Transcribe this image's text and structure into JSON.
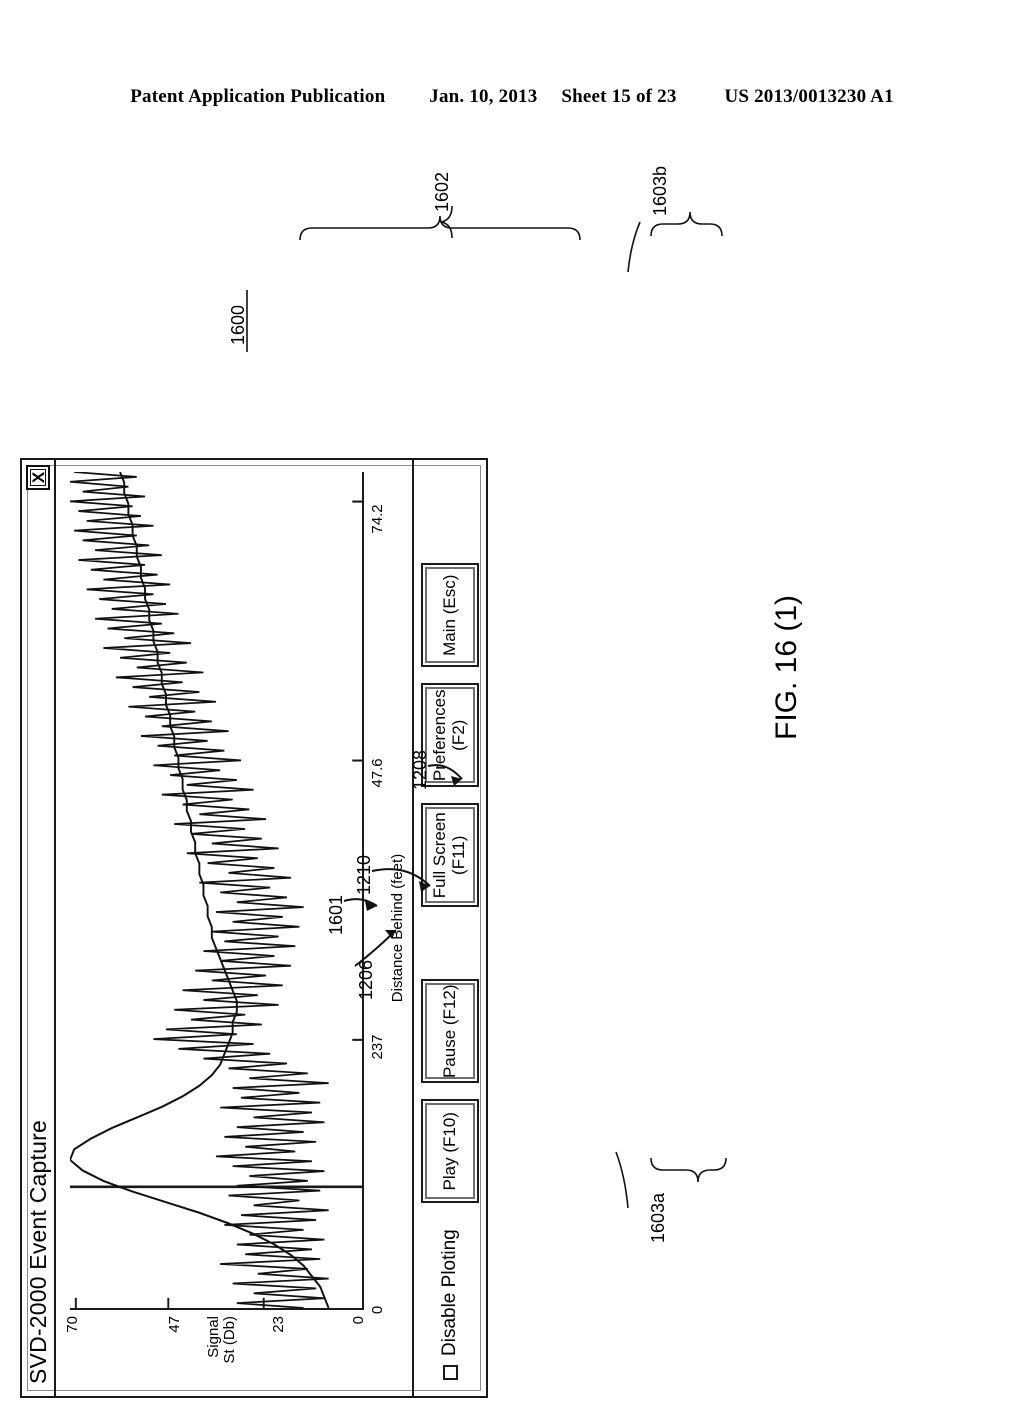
{
  "patent_header": {
    "publication": "Patent Application Publication",
    "date": "Jan. 10, 2013",
    "sheet": "Sheet 15 of 23",
    "number": "US 2013/0013230 A1"
  },
  "figure": {
    "caption": "FIG. 16 (1)",
    "reference_numerals": [
      {
        "id": "1600",
        "label": "1600"
      },
      {
        "id": "1601",
        "label": "1601"
      },
      {
        "id": "1602",
        "label": "1602"
      },
      {
        "id": "1603a",
        "label": "1603a"
      },
      {
        "id": "1603b",
        "label": "1603b"
      },
      {
        "id": "1206",
        "label": "1206"
      },
      {
        "id": "1208",
        "label": "1208"
      },
      {
        "id": "1210",
        "label": "1210"
      }
    ]
  },
  "window": {
    "title": "SVD-2000 Event Capture",
    "close_label": "X"
  },
  "controls": {
    "checkbox_label": "Disable Ploting",
    "checkbox_checked": false,
    "buttons": [
      {
        "label": "Play (F10)",
        "name": "play-button"
      },
      {
        "label": "Pause (F12)",
        "name": "pause-button"
      },
      {
        "label": "Full Screen\n(F11)",
        "line1": "Full Screen",
        "line2": "(F11)",
        "name": "full-screen-button"
      },
      {
        "label": "Preferences\n(F2)",
        "line1": "Preferences",
        "line2": "(F2)",
        "name": "preferences-button"
      },
      {
        "label": "Main (Esc)",
        "name": "main-button"
      }
    ]
  },
  "chart_data": {
    "type": "line",
    "title": "",
    "xlabel": "Distance Behind (feet)",
    "ylabel": "Signal St (Db)",
    "ylabel_line1": "Signal",
    "ylabel_line2": "St (Db)",
    "xticks": [
      "0",
      "237",
      "47.6",
      "74.2"
    ],
    "xtick_positions": [
      0,
      0.32,
      0.655,
      0.965
    ],
    "yticks": [
      "0",
      "23",
      "47",
      "70"
    ],
    "ytick_positions": [
      0,
      0.33,
      0.67,
      1.0
    ],
    "xlim": [
      0,
      74.2
    ],
    "ylim": [
      0,
      70
    ],
    "grid": false,
    "legend": "none",
    "series": [
      {
        "name": "noisy-signal-trace",
        "note": "high-frequency oscillating received signal strength trace",
        "values": [
          14,
          30,
          9,
          26,
          11,
          31,
          8,
          25,
          13,
          34,
          10,
          28,
          12,
          30,
          9,
          27,
          14,
          33,
          11,
          29,
          8,
          26,
          15,
          32,
          10,
          30,
          13,
          27,
          9,
          31,
          12,
          35,
          16,
          28,
          11,
          33,
          14,
          30,
          9,
          26,
          12,
          34,
          10,
          29,
          15,
          31,
          8,
          27,
          13,
          32,
          18,
          38,
          22,
          44,
          26,
          50,
          30,
          47,
          24,
          41,
          28,
          45,
          20,
          38,
          25,
          43,
          19,
          36,
          23,
          40,
          17,
          34,
          21,
          38,
          16,
          33,
          20,
          36,
          15,
          31,
          19,
          35,
          14,
          30,
          18,
          34,
          22,
          39,
          17,
          32,
          21,
          37,
          25,
          42,
          20,
          36,
          24,
          41,
          28,
          45,
          23,
          39,
          27,
          43,
          31,
          48,
          26,
          42,
          30,
          46,
          34,
          50,
          29,
          45,
          33,
          49,
          37,
          53,
          32,
          48,
          36,
          52,
          40,
          56,
          35,
          51,
          39,
          55,
          43,
          59,
          38,
          54,
          42,
          58,
          46,
          62,
          41,
          57,
          45,
          61,
          48,
          64,
          44,
          60,
          47,
          63,
          50,
          66,
          46,
          62,
          49,
          65,
          52,
          68,
          48,
          64,
          51,
          67,
          54,
          69,
          50,
          66,
          53,
          68,
          55,
          70,
          52,
          67,
          56,
          70,
          54,
          69
        ]
      },
      {
        "name": "smooth-envelope-trace",
        "note": "smooth averaged envelope trace with major peak near start",
        "values": [
          8,
          9,
          10,
          12,
          14,
          17,
          21,
          26,
          32,
          39,
          47,
          55,
          62,
          67,
          70,
          69,
          65,
          60,
          54,
          48,
          43,
          39,
          36,
          34,
          33,
          32,
          31,
          31,
          30,
          30,
          31,
          32,
          33,
          34,
          35,
          36,
          36,
          37,
          37,
          38,
          38,
          39,
          39,
          40,
          40,
          41,
          41,
          42,
          42,
          43,
          43,
          44,
          44,
          45,
          45,
          46,
          46,
          47,
          47,
          48,
          48,
          49,
          49,
          50,
          50,
          51,
          51,
          52,
          52,
          53,
          53,
          54,
          54,
          55,
          55,
          56,
          56,
          57,
          57,
          58
        ]
      }
    ],
    "cursor_line": {
      "name": "vertical-cursor",
      "x_fraction": 0.145
    }
  }
}
